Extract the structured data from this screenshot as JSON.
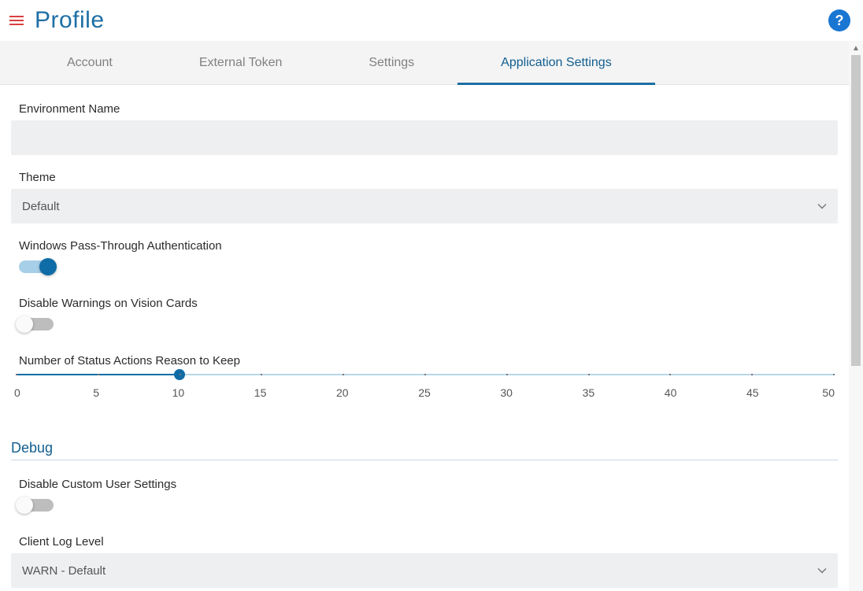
{
  "header": {
    "title": "Profile"
  },
  "tabs": [
    {
      "label": "Account",
      "active": false
    },
    {
      "label": "External Token",
      "active": false
    },
    {
      "label": "Settings",
      "active": false
    },
    {
      "label": "Application Settings",
      "active": true
    }
  ],
  "form": {
    "environment_name": {
      "label": "Environment Name",
      "value": ""
    },
    "theme": {
      "label": "Theme",
      "value": "Default"
    },
    "win_passthrough": {
      "label": "Windows Pass-Through Authentication",
      "on": true
    },
    "disable_warnings": {
      "label": "Disable Warnings on Vision Cards",
      "on": false
    },
    "status_actions": {
      "label": "Number of Status Actions Reason to Keep",
      "min": 0,
      "max": 50,
      "value": 10,
      "ticks": [
        0,
        5,
        10,
        15,
        20,
        25,
        30,
        35,
        40,
        45,
        50
      ]
    }
  },
  "debug": {
    "heading": "Debug",
    "disable_custom": {
      "label": "Disable Custom User Settings",
      "on": false
    },
    "client_log_level": {
      "label": "Client Log Level",
      "value": "WARN - Default"
    }
  }
}
